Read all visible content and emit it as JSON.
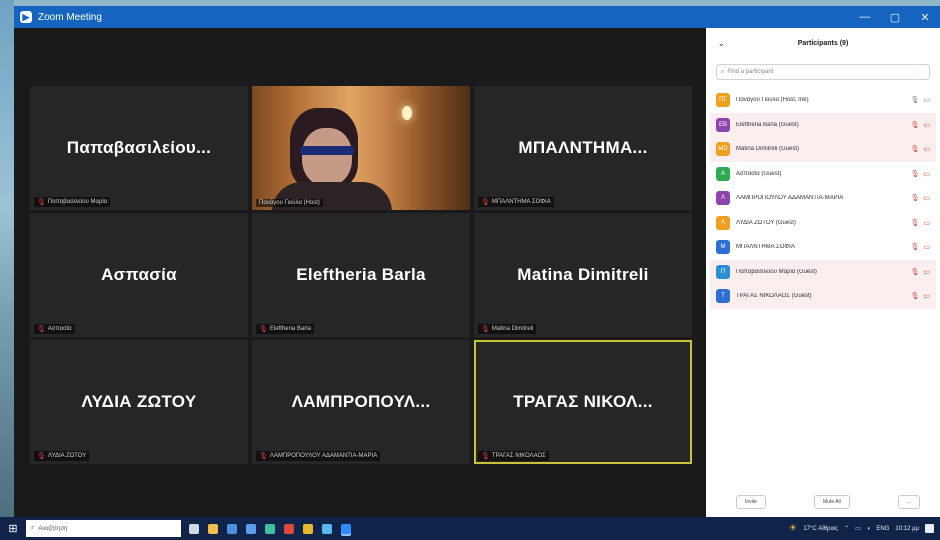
{
  "window": {
    "title": "Zoom Meeting",
    "icon": "zoom-icon",
    "controls": [
      "—",
      "▢",
      "✕"
    ]
  },
  "gallery": {
    "tiles": [
      {
        "name": "Παπαβασιλείου...",
        "label": "Παπαβασιλείου Μαρία",
        "muted": true,
        "video": false,
        "active": false
      },
      {
        "name": "",
        "label": "Πανάγου Γιούλα (Host)",
        "muted": false,
        "video": true,
        "active": false
      },
      {
        "name": "ΜΠΑΛΝΤΗΜΑ...",
        "label": "ΜΠΑΛΝΤΗΜΑ ΣΟΦΙΑ",
        "muted": true,
        "video": false,
        "active": false
      },
      {
        "name": "Ασπασία",
        "label": "Ασπασία",
        "muted": true,
        "video": false,
        "active": false
      },
      {
        "name": "Eleftheria Barla",
        "label": "Eleftheria Barla",
        "muted": true,
        "video": false,
        "active": false
      },
      {
        "name": "Matina Dimitreli",
        "label": "Matina Dimitreli",
        "muted": true,
        "video": false,
        "active": false
      },
      {
        "name": "ΛΥΔΙΑ ΖΩΤΟΥ",
        "label": "ΛΥΔΙΑ ΖΩΤΟΥ",
        "muted": true,
        "video": false,
        "active": false
      },
      {
        "name": "ΛΑΜΠΡΟΠΟΥΛ...",
        "label": "ΛΑΜΠΡΟΠΟΥΛΟΥ ΑΔΑΜΑΝΤΙΑ-ΜΑΡΙΑ",
        "muted": true,
        "video": false,
        "active": false
      },
      {
        "name": "ΤΡΑΓΑΣ  ΝΙΚΟΛ...",
        "label": "ΤΡΑΓΑΣ ΝΙΚΟΛΑΟΣ",
        "muted": true,
        "video": false,
        "active": true
      }
    ]
  },
  "participants": {
    "title": "Participants (9)",
    "search_placeholder": "Find a participant",
    "list": [
      {
        "initials": "ΠΓ",
        "color": "#f0a020",
        "name": "Πανάγου Γιούλα (Host, me)",
        "host": true,
        "shaded": false
      },
      {
        "initials": "EB",
        "color": "#8e44ad",
        "name": "Eleftheria Barla (Guest)",
        "host": false,
        "shaded": true
      },
      {
        "initials": "MD",
        "color": "#f0a020",
        "name": "Matina Dimitreli (Guest)",
        "host": false,
        "shaded": true
      },
      {
        "initials": "A",
        "color": "#2eaa52",
        "name": "Ασπασία (Guest)",
        "host": false,
        "shaded": false
      },
      {
        "initials": "Λ",
        "color": "#8e44ad",
        "name": "ΛΑΜΠΡΟΠΟΥΛΟΥ ΑΔΑΜΑΝΤΙΑ-ΜΑΡΙΑ",
        "host": false,
        "shaded": false
      },
      {
        "initials": "Λ",
        "color": "#f0a020",
        "name": "ΛΥΔΙΑ ΖΩΤΟΥ (Guest)",
        "host": false,
        "shaded": false
      },
      {
        "initials": "M",
        "color": "#2d6fd3",
        "name": "ΜΠΑΛΝΤΗΜΑ ΣΟΦΙΑ",
        "host": false,
        "shaded": false
      },
      {
        "initials": "Π",
        "color": "#2d8fd3",
        "name": "Παπαβασιλείου Μαρία (Guest)",
        "host": false,
        "shaded": true
      },
      {
        "initials": "T",
        "color": "#2d6fd3",
        "name": "ΤΡΑΓΑΣ ΝΙΚΟΛΑΟΣ (Guest)",
        "host": false,
        "shaded": true
      }
    ],
    "buttons": {
      "invite": "Invite",
      "mute_all": "Mute All",
      "more": "..."
    }
  },
  "taskbar": {
    "search_text": "Αναζήτηση",
    "weather": "17°C Αίθριος",
    "language": "ENG",
    "time": "10:12 μμ",
    "apps": [
      {
        "name": "task-view-icon",
        "color": "#cfd8e6"
      },
      {
        "name": "file-explorer-icon",
        "color": "#f2c04a"
      },
      {
        "name": "mail-icon",
        "color": "#4b8fe0"
      },
      {
        "name": "store-icon",
        "color": "#5aa0f0"
      },
      {
        "name": "edge-icon",
        "color": "#3fc0a0"
      },
      {
        "name": "office-icon",
        "color": "#e0483a"
      },
      {
        "name": "chrome-icon",
        "color": "#e9b730"
      },
      {
        "name": "photos-icon",
        "color": "#5bb8ef"
      },
      {
        "name": "zoom-icon",
        "color": "#2d8cff"
      }
    ]
  }
}
